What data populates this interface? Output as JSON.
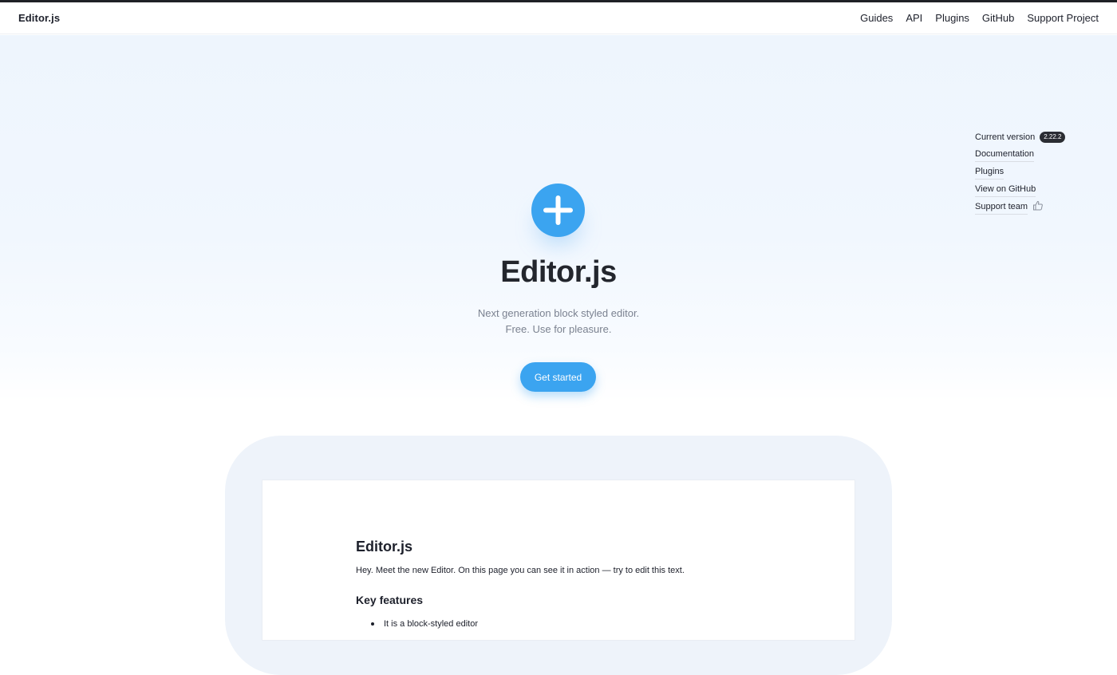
{
  "navbar": {
    "brand": "Editor.js",
    "links": [
      "Guides",
      "API",
      "Plugins",
      "GitHub",
      "Support Project"
    ]
  },
  "side_menu": {
    "current_version_label": "Current version",
    "version": "2.22.2",
    "documentation": "Documentation",
    "plugins": "Plugins",
    "view_on_github": "View on GitHub",
    "support_team": "Support team"
  },
  "hero": {
    "title": "Editor.js",
    "subtitle_line1": "Next generation block styled editor.",
    "subtitle_line2": "Free. Use for pleasure.",
    "cta_label": "Get started"
  },
  "demo": {
    "title": "Editor.js",
    "paragraph": "Hey. Meet the new Editor. On this page you can see it in action — try to edit this text.",
    "heading": "Key features",
    "list_items": [
      "It is a block-styled editor"
    ]
  },
  "colors": {
    "accent": "#3ba4f0",
    "text": "#1d202b",
    "badge_bg": "#2b2d33"
  },
  "icons": [
    "plus-icon",
    "thumbs-up-icon"
  ]
}
